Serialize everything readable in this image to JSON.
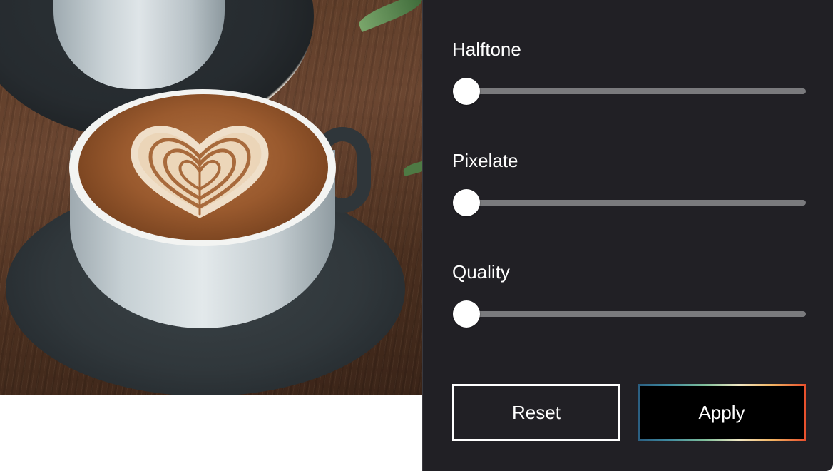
{
  "photo": {
    "subject": "latte-art-coffee-cup-icon"
  },
  "panel": {
    "controls": [
      {
        "label": "Halftone",
        "value": 0
      },
      {
        "label": "Pixelate",
        "value": 0
      },
      {
        "label": "Quality",
        "value": 0
      }
    ],
    "reset_label": "Reset",
    "apply_label": "Apply"
  },
  "colors": {
    "panel_background": "#212025",
    "track": "#7a7a7d",
    "thumb": "#ffffff",
    "apply_gradient": [
      "#2a5d80",
      "#7fbf9b",
      "#f1e8c4",
      "#f2b463",
      "#e84f2c"
    ]
  }
}
